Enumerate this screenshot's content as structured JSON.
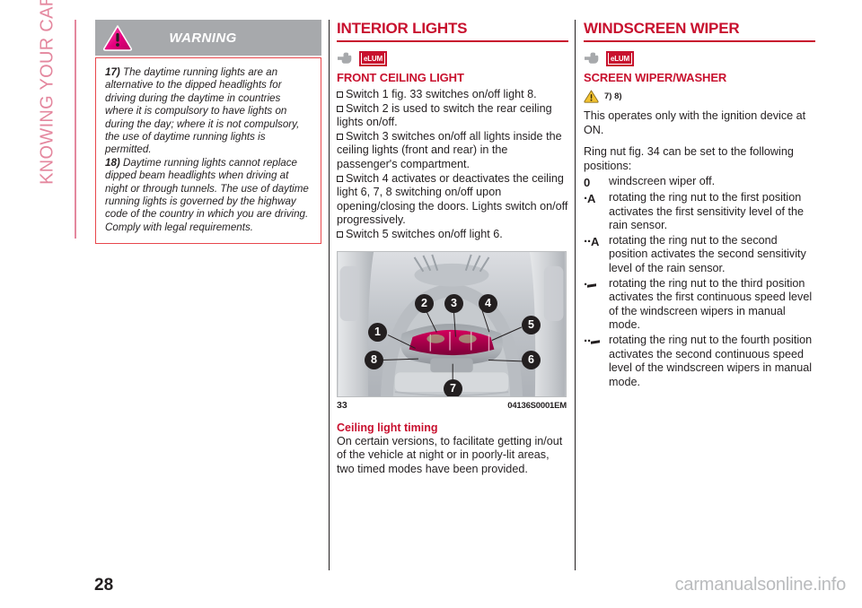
{
  "chapter": {
    "label": "KNOWING YOUR CAR"
  },
  "warning": {
    "banner_title": "WARNING",
    "icon": "warning-triangle-pink-icon",
    "items": [
      {
        "num": "17)",
        "text": "The daytime running lights are an alternative to the dipped headlights for driving during the daytime in countries where it is compulsory to have lights on during the day; where it is not compulsory, the use of daytime running lights is permitted."
      },
      {
        "num": "18)",
        "text": "Daytime running lights cannot replace dipped beam headlights when driving at night or through tunnels. The use of daytime running lights is governed by the highway code of the country in which you are driving. Comply with legal requirements."
      }
    ]
  },
  "interior_lights": {
    "section_title": "INTERIOR LIGHTS",
    "hand_icon": "pointing-hand-icon",
    "elum_badge": "eLUM",
    "subsection_title": "FRONT CEILING LIGHT",
    "bullets": [
      "Switch 1 fig. 33 switches on/off light 8.",
      "Switch 2 is used to switch the rear ceiling lights on/off.",
      "Switch 3 switches on/off all lights inside the ceiling lights (front and rear) in the passenger's compartment.",
      "Switch 4 activates or deactivates the ceiling light 6, 7, 8 switching on/off upon opening/closing the doors. Lights switch on/off progressively.",
      "Switch 5 switches on/off light 6."
    ],
    "figure": {
      "caption_number": "33",
      "caption_code": "04136S0001EM",
      "callouts": [
        "1",
        "2",
        "3",
        "4",
        "5",
        "6",
        "7",
        "8"
      ]
    },
    "timing_title": "Ceiling light timing",
    "timing_text": "On certain versions, to facilitate getting in/out of the vehicle at night or in poorly-lit areas, two timed modes have been provided."
  },
  "windscreen_wiper": {
    "section_title": "WINDSCREEN WIPER",
    "hand_icon": "pointing-hand-icon",
    "elum_badge": "eLUM",
    "subsection_title": "SCREEN WIPER/WASHER",
    "amber_icon": "warning-triangle-amber-icon",
    "ref_marks": "7) 8)",
    "para_1": "This operates only with the ignition device at ON.",
    "para_2": "Ring nut fig. 34 can be set to the following positions:",
    "positions": [
      {
        "symbol": "0",
        "symbol_type": "zero",
        "text": "windscreen wiper off."
      },
      {
        "symbol": "•A",
        "symbol_type": "dot-a",
        "text": "rotating the ring nut to the first position activates the first sensitivity level of the rain sensor."
      },
      {
        "symbol": "••A",
        "symbol_type": "dotdot-a",
        "text": "rotating the ring nut to the second position activates the second sensitivity level of the rain sensor."
      },
      {
        "symbol": "•—",
        "symbol_type": "dot-dash",
        "text": "rotating the ring nut to the third position activates the first continuous speed level of the windscreen wipers in manual mode."
      },
      {
        "symbol": "••—",
        "symbol_type": "dotdot-dash",
        "text": "rotating the ring nut to the fourth position activates the second continuous speed level of the windscreen wipers in manual mode."
      }
    ]
  },
  "footer": {
    "page_number": "28",
    "watermark": "carmanualsonline.info"
  },
  "colors": {
    "accent_red": "#c8102e",
    "warning_border": "#e8474c",
    "banner_gray": "#a7a9ac",
    "sidebar_pink": "#e4879e",
    "text": "#231f20",
    "amber": "#f0c419"
  }
}
